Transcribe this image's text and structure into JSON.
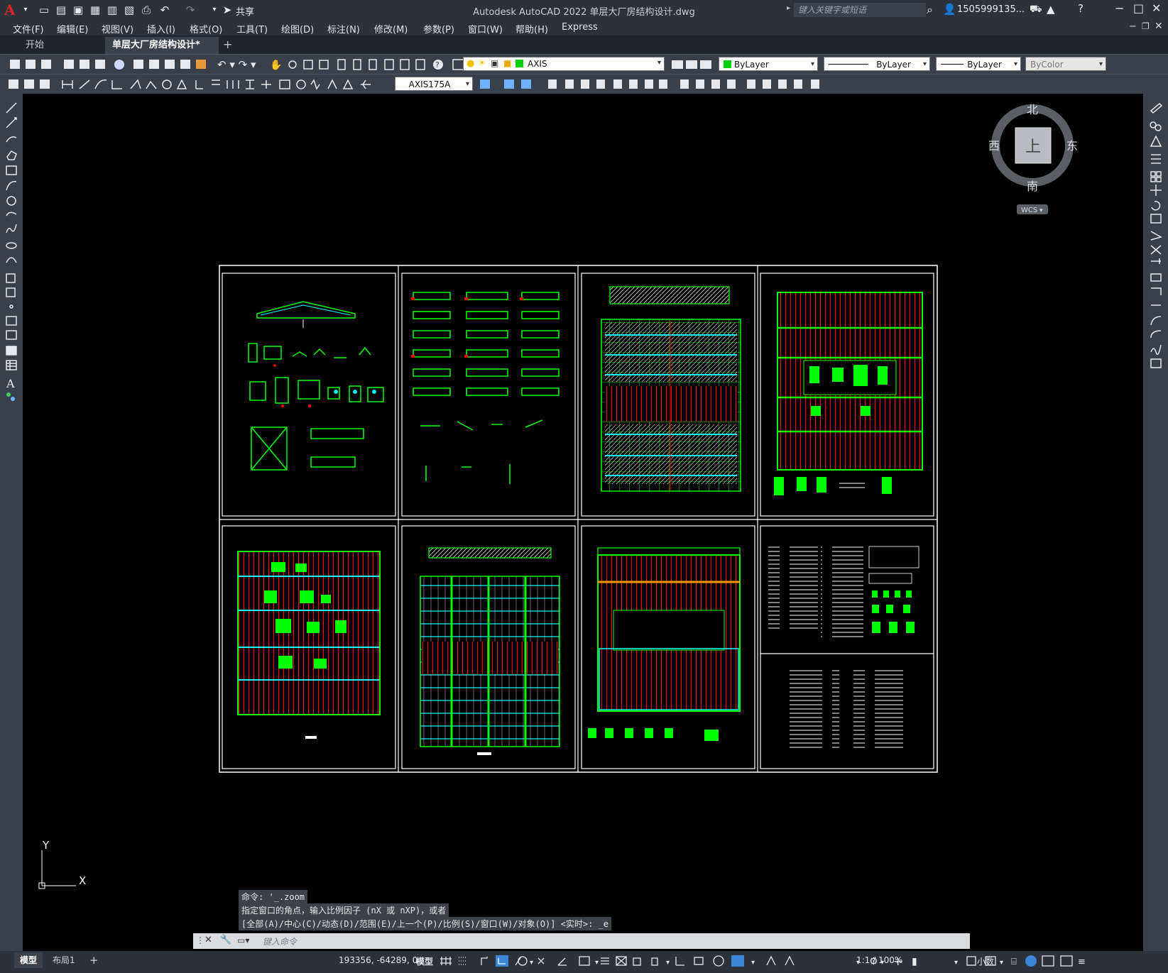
{
  "app": {
    "title": "Autodesk AutoCAD 2022    单层大厂房结构设计.dwg",
    "logo": "A",
    "share_label": "共享",
    "search_placeholder": "键入关键字或短语",
    "user": "1505999135..."
  },
  "menu": [
    "文件(F)",
    "编辑(E)",
    "视图(V)",
    "插入(I)",
    "格式(O)",
    "工具(T)",
    "绘图(D)",
    "标注(N)",
    "修改(M)",
    "参数(P)",
    "窗口(W)",
    "帮助(H)",
    "Express"
  ],
  "tabs": [
    {
      "label": "开始",
      "active": false
    },
    {
      "label": "单层大厂房结构设计*",
      "active": true
    }
  ],
  "toolbar": {
    "layer": "AXIS",
    "color": "ByLayer",
    "linetype": "ByLayer",
    "lineweight": "ByLayer",
    "plotstyle": "ByColor",
    "dimstyle": "AXIS175A"
  },
  "viewcube": {
    "north": "北",
    "south": "南",
    "east": "东",
    "west": "西",
    "face": "上",
    "wcs": "WCS"
  },
  "ucs": {
    "x": "X",
    "y": "Y"
  },
  "command": {
    "history": [
      "命令: '_.zoom",
      "指定窗口的角点，输入比例因子 (nX 或 nXP)，或者",
      "[全部(A)/中心(C)/动态(D)/范围(E)/上一个(P)/比例(S)/窗口(W)/对象(O)] <实时>: _e"
    ],
    "placeholder": "键入命令"
  },
  "status": {
    "model_tab": "模型",
    "layout_tab": "布局1",
    "coords": "193356, -64289, 0",
    "space": "模型",
    "scale": "1:1 / 100%",
    "units": "小数"
  },
  "colors": {
    "canvas": "#000000",
    "green": "#00ff00",
    "red": "#ff0000",
    "cyan": "#00ffff",
    "white": "#ffffff"
  }
}
